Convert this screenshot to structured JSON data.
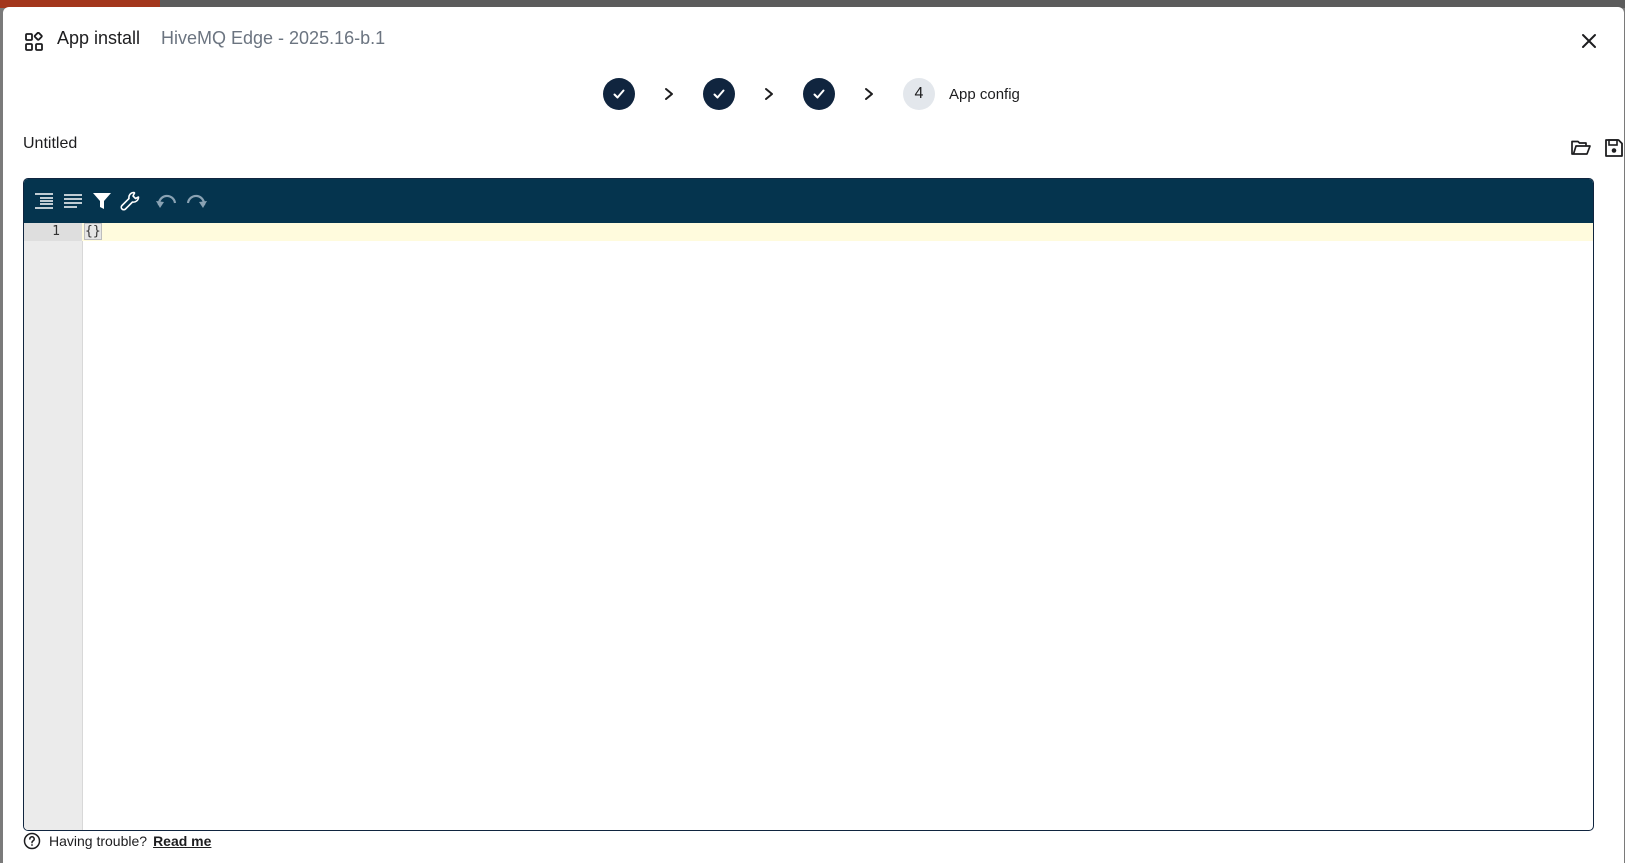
{
  "dialog": {
    "title": "App install",
    "subtitle": "HiveMQ Edge - 2025.16-b.1",
    "icon": "apps-grid-icon"
  },
  "stepper": {
    "steps": [
      {
        "state": "complete",
        "icon": "check-icon"
      },
      {
        "state": "complete",
        "icon": "check-icon"
      },
      {
        "state": "complete",
        "icon": "check-icon"
      },
      {
        "state": "current",
        "number": "4",
        "label": "App config"
      }
    ]
  },
  "document": {
    "title": "Untitled"
  },
  "editor": {
    "toolbar": [
      "format-icon",
      "compact-icon",
      "filter-icon",
      "repair-icon",
      "undo-icon",
      "redo-icon"
    ],
    "lines": [
      {
        "number": "1",
        "text": "{}"
      }
    ]
  },
  "footer": {
    "question": "Having trouble?",
    "link": "Read me"
  },
  "colors": {
    "primary": "#10253f",
    "toolbar": "#05344e",
    "active_line": "#fffbdd",
    "step_pending": "#e3e7ec"
  }
}
